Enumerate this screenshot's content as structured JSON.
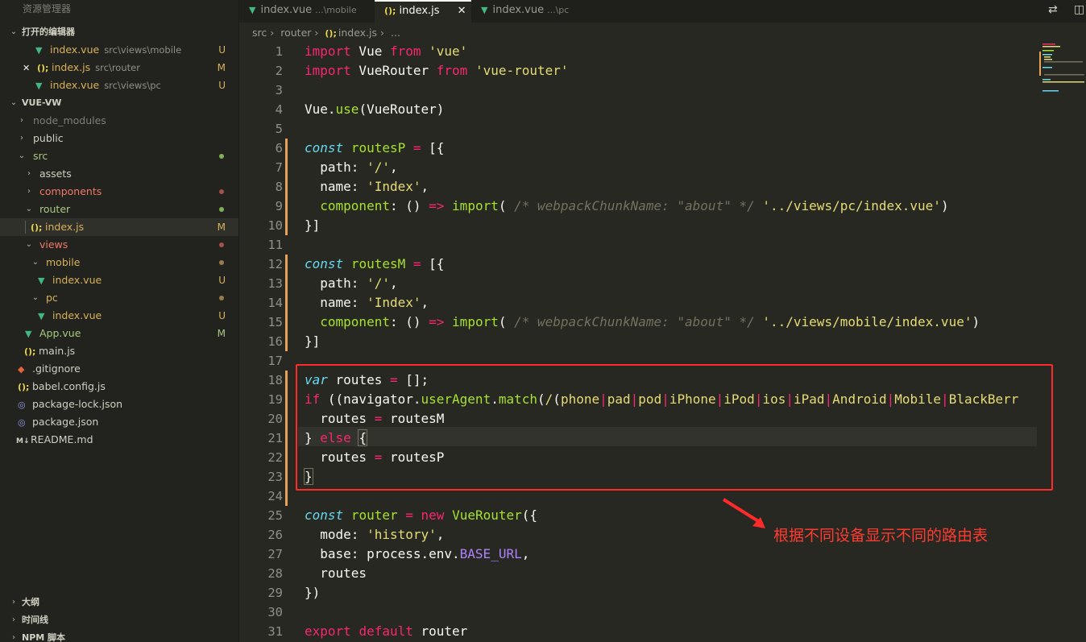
{
  "sidebar": {
    "title": "资源管理器",
    "open_editors": {
      "label": "打开的编辑器",
      "items": [
        {
          "name": "index.vue",
          "desc": "src\\views\\mobile",
          "badge": "U"
        },
        {
          "name": "index.js",
          "desc": "src\\router",
          "badge": "M"
        },
        {
          "name": "index.vue",
          "desc": "src\\views\\pc",
          "badge": "U"
        }
      ]
    },
    "project": {
      "label": "VUE-VW",
      "tree": [
        {
          "name": "node_modules"
        },
        {
          "name": "public"
        },
        {
          "name": "src"
        },
        {
          "name": "assets"
        },
        {
          "name": "components"
        },
        {
          "name": "router"
        },
        {
          "name": "index.js",
          "badge": "M"
        },
        {
          "name": "views"
        },
        {
          "name": "mobile"
        },
        {
          "name": "index.vue",
          "badge": "U"
        },
        {
          "name": "pc"
        },
        {
          "name": "index.vue",
          "badge": "U"
        },
        {
          "name": "App.vue",
          "badge": "M"
        },
        {
          "name": "main.js"
        },
        {
          "name": ".gitignore"
        },
        {
          "name": "babel.config.js"
        },
        {
          "name": "package-lock.json"
        },
        {
          "name": "package.json"
        },
        {
          "name": "README.md"
        }
      ]
    },
    "bottom_sections": [
      "大纲",
      "时间线",
      "NPM 脚本"
    ]
  },
  "tabs": [
    {
      "name": "index.vue",
      "desc": "...\\mobile"
    },
    {
      "name": "index.js",
      "close": "✕"
    },
    {
      "name": "index.vue",
      "desc": "...\\pc"
    }
  ],
  "breadcrumb": [
    "src",
    "router",
    "index.js",
    "..."
  ],
  "line_numbers": [
    "1",
    "2",
    "3",
    "4",
    "5",
    "6",
    "7",
    "8",
    "9",
    "10",
    "11",
    "12",
    "13",
    "14",
    "15",
    "16",
    "17",
    "18",
    "19",
    "20",
    "21",
    "22",
    "23",
    "24",
    "25",
    "26",
    "27",
    "28",
    "29",
    "30",
    "31"
  ],
  "annotation": "根据不同设备显示不同的路由表",
  "colors": {
    "highlight_box": "#ff2a2a",
    "annotation": "#ff3b30",
    "editor_bg": "#272822"
  }
}
